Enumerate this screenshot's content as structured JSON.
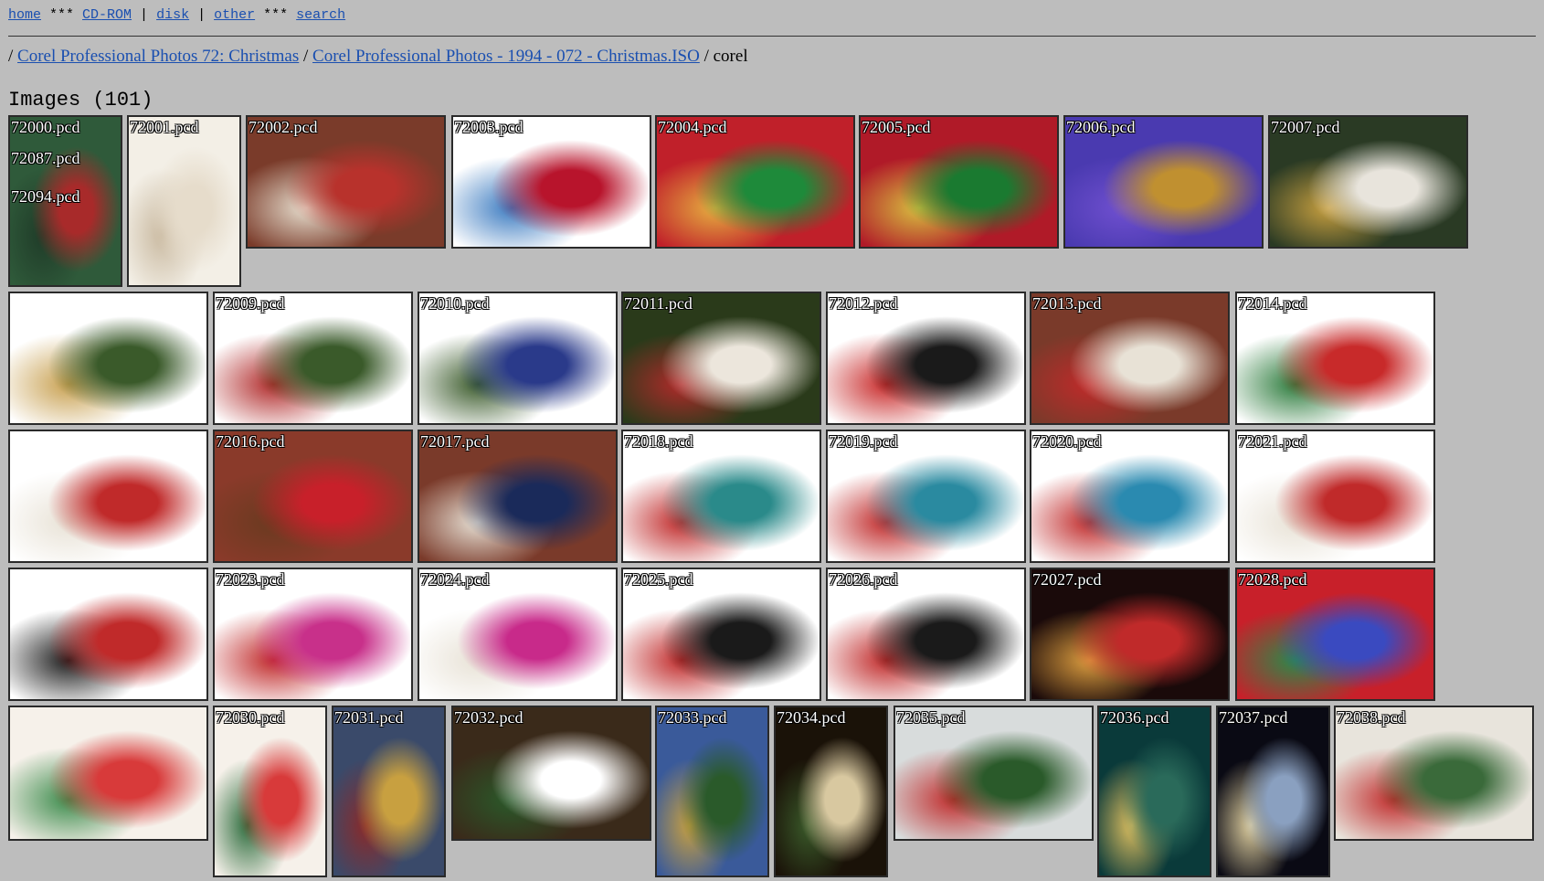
{
  "nav": {
    "home": "home",
    "sep1": " *** ",
    "cdrom": "CD-ROM",
    "sep2": " | ",
    "disk": "disk",
    "sep3": " | ",
    "other": "other",
    "sep4": " *** ",
    "search": "search"
  },
  "breadcrumb": {
    "lead": "/ ",
    "link1": "Corel Professional Photos 72: Christmas",
    "sep": " / ",
    "link2": "Corel Professional Photos - 1994 - 072 - Christmas.ISO",
    "tail": " / corel"
  },
  "heading": "Images (101)",
  "thumbs": [
    {
      "labels": [
        "72000.pcd",
        "72087.pcd",
        "72094.pcd"
      ],
      "desc": "green wreath with red bow",
      "colors": [
        "#2f5a3a",
        "#a82a2a",
        "#1f3b28"
      ]
    },
    {
      "labels": [
        "72001.pcd"
      ],
      "desc": "santa beard close-up",
      "colors": [
        "#f3efe6",
        "#e6dccb",
        "#c9b9a0"
      ]
    },
    {
      "labels": [
        "72002.pcd"
      ],
      "desc": "santa hanging stockings by brick fireplace",
      "colors": [
        "#7a3b2a",
        "#b8322c",
        "#e8e0d0"
      ]
    },
    {
      "labels": [
        "72003.pcd"
      ],
      "desc": "red sack with wrapped gifts and teddy bear",
      "colors": [
        "#ffffff",
        "#b8142c",
        "#3a7ac0"
      ]
    },
    {
      "labels": [
        "72004.pcd"
      ],
      "desc": "wrapping paper rolls and scissors",
      "colors": [
        "#c0202a",
        "#1e8a3a",
        "#e6b040"
      ]
    },
    {
      "labels": [
        "72005.pcd"
      ],
      "desc": "foil wrapping paper rolls",
      "colors": [
        "#b01a28",
        "#1a7a30",
        "#d8c040"
      ]
    },
    {
      "labels": [
        "72006.pcd"
      ],
      "desc": "ornaments on purple tissue",
      "colors": [
        "#4a3ab0",
        "#c09030",
        "#7050d0"
      ]
    },
    {
      "labels": [
        "72007.pcd"
      ],
      "desc": "santa hand with gift in tree",
      "colors": [
        "#2a3a24",
        "#e8e4dc",
        "#c8a040"
      ]
    },
    {
      "labels": [],
      "desc": "snowman ornament in tree",
      "colors": [
        "#ffffff",
        "#3a5a2a",
        "#c8a050"
      ]
    },
    {
      "labels": [
        "72009.pcd"
      ],
      "desc": "clock ornament in tree",
      "colors": [
        "#ffffff",
        "#3a5a2a",
        "#b02a2a"
      ]
    },
    {
      "labels": [
        "72010.pcd"
      ],
      "desc": "blue ball ornament",
      "colors": [
        "#ffffff",
        "#2a3a8a",
        "#3a5a2a"
      ]
    },
    {
      "labels": [
        "72011.pcd"
      ],
      "desc": "santa with pig ornament by tree",
      "colors": [
        "#2a3a1a",
        "#ece6dc",
        "#b02a2a"
      ]
    },
    {
      "labels": [
        "72012.pcd"
      ],
      "desc": "baby in santa hat and boot",
      "colors": [
        "#ffffff",
        "#1a1a1a",
        "#c82a2a"
      ]
    },
    {
      "labels": [
        "72013.pcd"
      ],
      "desc": "boy with santa by brick wall",
      "colors": [
        "#7a3a2a",
        "#e8e2d6",
        "#c02a2a"
      ]
    },
    {
      "labels": [
        "72014.pcd"
      ],
      "desc": "santa with armful of presents",
      "colors": [
        "#ffffff",
        "#c82a2a",
        "#2a7a3a"
      ]
    },
    {
      "labels": [],
      "desc": "santa holding gift",
      "colors": [
        "#ffffff",
        "#c02a2a",
        "#e8e2d6"
      ]
    },
    {
      "labels": [
        "72016.pcd"
      ],
      "desc": "stockings on brick fireplace",
      "colors": [
        "#8a3a2a",
        "#c8202a",
        "#6a3a20"
      ]
    },
    {
      "labels": [
        "72017.pcd"
      ],
      "desc": "boy and santa with stocking",
      "colors": [
        "#7a3a2a",
        "#1a2a5a",
        "#e8e2d6"
      ]
    },
    {
      "labels": [
        "72018.pcd"
      ],
      "desc": "girl giving gift to santa",
      "colors": [
        "#ffffff",
        "#2a8a8a",
        "#c02a2a"
      ]
    },
    {
      "labels": [
        "72019.pcd"
      ],
      "desc": "girl hugging santa",
      "colors": [
        "#ffffff",
        "#2a8aa0",
        "#c02a2a"
      ]
    },
    {
      "labels": [
        "72020.pcd"
      ],
      "desc": "girl hugging santa",
      "colors": [
        "#ffffff",
        "#2a8ab0",
        "#c02a2a"
      ]
    },
    {
      "labels": [
        "72021.pcd"
      ],
      "desc": "santa portrait",
      "colors": [
        "#ffffff",
        "#c02a2a",
        "#e8e2d6"
      ]
    },
    {
      "labels": [],
      "desc": "santa seated",
      "colors": [
        "#ffffff",
        "#c02a2a",
        "#1a1a1a"
      ]
    },
    {
      "labels": [
        "72023.pcd"
      ],
      "desc": "girl and santa",
      "colors": [
        "#ffffff",
        "#c8308a",
        "#c02a2a"
      ]
    },
    {
      "labels": [
        "72024.pcd"
      ],
      "desc": "girl hugging santa",
      "colors": [
        "#ffffff",
        "#c82a8a",
        "#e8e2d6"
      ]
    },
    {
      "labels": [
        "72025.pcd"
      ],
      "desc": "woman kissing santa",
      "colors": [
        "#ffffff",
        "#1a1a1a",
        "#c02a2a"
      ]
    },
    {
      "labels": [
        "72026.pcd"
      ],
      "desc": "woman with santa",
      "colors": [
        "#ffffff",
        "#1a1a1a",
        "#c02a2a"
      ]
    },
    {
      "labels": [
        "72027.pcd"
      ],
      "desc": "house door with christmas lights",
      "colors": [
        "#1a0a0a",
        "#c02a2a",
        "#e0a040"
      ]
    },
    {
      "labels": [
        "72028.pcd"
      ],
      "desc": "ribbon spools",
      "colors": [
        "#c8202a",
        "#3a4ac0",
        "#2a8a4a"
      ]
    },
    {
      "labels": [],
      "desc": "candy cane lying flat",
      "colors": [
        "#f6f1ea",
        "#d83a3a",
        "#3a8a4a"
      ]
    },
    {
      "labels": [
        "72030.pcd"
      ],
      "desc": "candy cane with bow",
      "colors": [
        "#f6f1ea",
        "#d83a3a",
        "#2a6a3a"
      ]
    },
    {
      "labels": [
        "72031.pcd"
      ],
      "desc": "outdoor lamp with greenery",
      "colors": [
        "#3a4a6a",
        "#c8a040",
        "#8a2a2a"
      ]
    },
    {
      "labels": [
        "72032.pcd"
      ],
      "desc": "fireplace with wreath",
      "colors": [
        "#3a2a1a",
        "#ffffff",
        "#2a5a2a"
      ]
    },
    {
      "labels": [
        "72033.pcd"
      ],
      "desc": "door swag with horn",
      "colors": [
        "#3a5a9a",
        "#2a5a2a",
        "#c8a040"
      ]
    },
    {
      "labels": [
        "72034.pcd"
      ],
      "desc": "angel ornament at night",
      "colors": [
        "#1a1208",
        "#d8c8a0",
        "#3a5a2a"
      ]
    },
    {
      "labels": [
        "72035.pcd"
      ],
      "desc": "wreath on window",
      "colors": [
        "#d8dcdc",
        "#2a5a2a",
        "#c02a2a"
      ]
    },
    {
      "labels": [
        "72036.pcd"
      ],
      "desc": "lit tree in dark",
      "colors": [
        "#0a3a3a",
        "#2a6a5a",
        "#e0c060"
      ]
    },
    {
      "labels": [
        "72037.pcd"
      ],
      "desc": "snowy tree at night",
      "colors": [
        "#0a0a14",
        "#8aa0c0",
        "#e0d0a0"
      ]
    },
    {
      "labels": [
        "72038.pcd"
      ],
      "desc": "pine branch with pinecone and ribbon",
      "colors": [
        "#e8e4dc",
        "#3a6a3a",
        "#c02a2a"
      ]
    }
  ]
}
